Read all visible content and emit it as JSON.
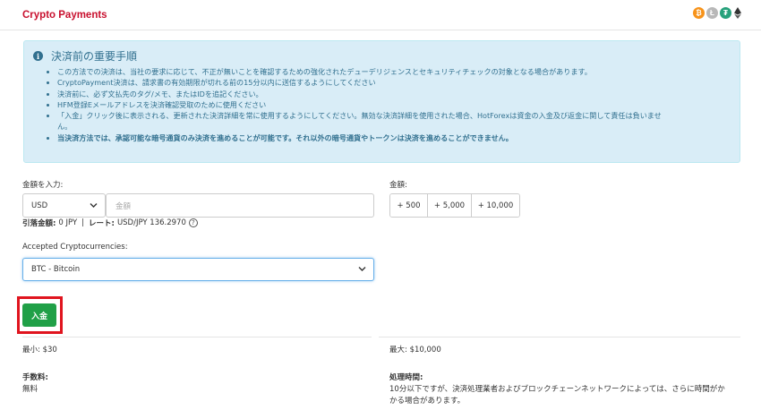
{
  "header": {
    "title": "Crypto Payments",
    "coins": {
      "btc": "₿",
      "ltc": "Ł",
      "usdt": "₮",
      "eth": "◆"
    }
  },
  "notice": {
    "title": "決済前の重要手順",
    "items": [
      "この方法での決済は、当社の要求に応じて、不正が無いことを確認するための強化されたデューデリジェンスとセキュリティチェックの対象となる場合があります。",
      "CryptoPayment決済は、請求書の有効期限が切れる前の15分以内に送信するようにしてください",
      "決済前に、必ず文払先のタグ/メモ、またはIDを追記ください。",
      "HFM登録Eメールアドレスを決済確認受取のために使用ください",
      "「入金」クリック後に表示される、更新された決済詳細を常に使用するようにしてください。無効な決済詳細を使用された場合、HotForexは資金の入金及び返金に関して責任は負いませ",
      "ん。",
      "当決済方法では、承認可能な暗号通貨のみ決済を進めることが可能です。それ以外の暗号通貨やトークンは決済を進めることができません。"
    ]
  },
  "form": {
    "amount_label": "金額を入力:",
    "currency_value": "USD",
    "amount_placeholder": "金額",
    "preset_label": "金額:",
    "presets": [
      "+ 500",
      "+ 5,000",
      "+ 10,000"
    ],
    "debit_label": "引落金額:",
    "debit_value": "0 JPY",
    "separator": "|",
    "rate_label": "レート:",
    "rate_value": "USD/JPY 136.2970",
    "help_icon": "?",
    "crypto_label": "Accepted Cryptocurrencies:",
    "crypto_value": "BTC - Bitcoin",
    "chevron": "⌄",
    "deposit_label": "入金"
  },
  "details": {
    "min_label": "最小:",
    "min_value": "$30",
    "max_label": "最大:",
    "max_value": "$10,000",
    "fee_label": "手数料:",
    "fee_value": "無料",
    "time_label": "処理時間:",
    "time_value_1": "10分以下ですが、決済処理業者およびブロックチェーンネットワークによっては、さらに時間がか",
    "time_value_2": "かる場合があります。"
  }
}
